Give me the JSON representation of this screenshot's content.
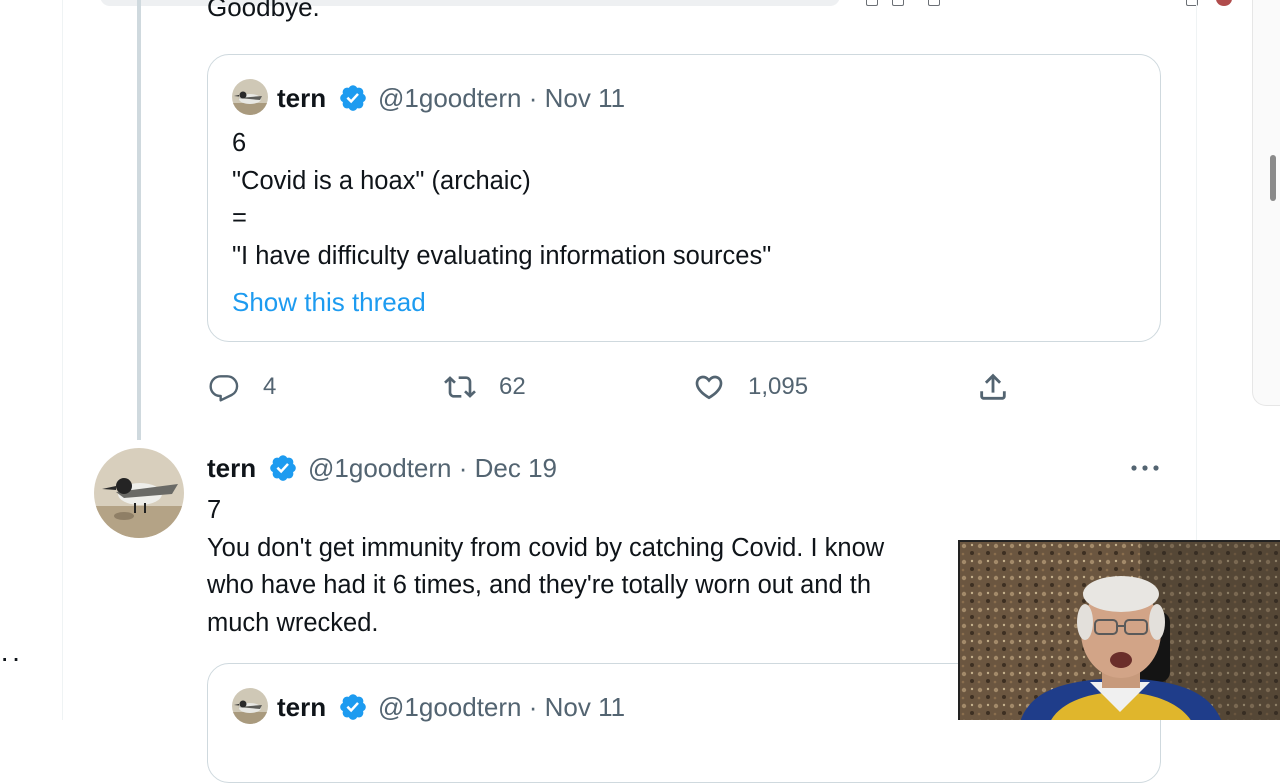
{
  "prev_tweet": {
    "text_tail": "Goodbye."
  },
  "quote1": {
    "name": "tern",
    "handle": "@1goodtern",
    "date": "Nov 11",
    "lines": [
      "6",
      "\"Covid is a hoax\" (archaic)",
      "=",
      "\"I have difficulty evaluating information sources\""
    ],
    "show_thread": "Show this thread"
  },
  "actions": {
    "reply_count": "4",
    "retweet_count": "62",
    "like_count": "1,095"
  },
  "tweet": {
    "name": "tern",
    "handle": "@1goodtern",
    "date": "Dec 19",
    "lines": [
      "7",
      "You don't get immunity from covid by catching Covid. I know",
      "who have had it 6 times, and they're totally worn out and th",
      "much wrecked."
    ]
  },
  "quote2": {
    "name": "tern",
    "handle": "@1goodtern",
    "date": "Nov 11"
  },
  "icons": {
    "reply": "reply-icon",
    "retweet": "retweet-icon",
    "like": "heart-icon",
    "share": "share-icon",
    "verified": "verified-badge-icon",
    "more": "more-icon"
  },
  "colors": {
    "link": "#1d9bf0",
    "secondary_text": "#536471",
    "border": "#cfd9de",
    "verified": "#1d9bf0"
  }
}
